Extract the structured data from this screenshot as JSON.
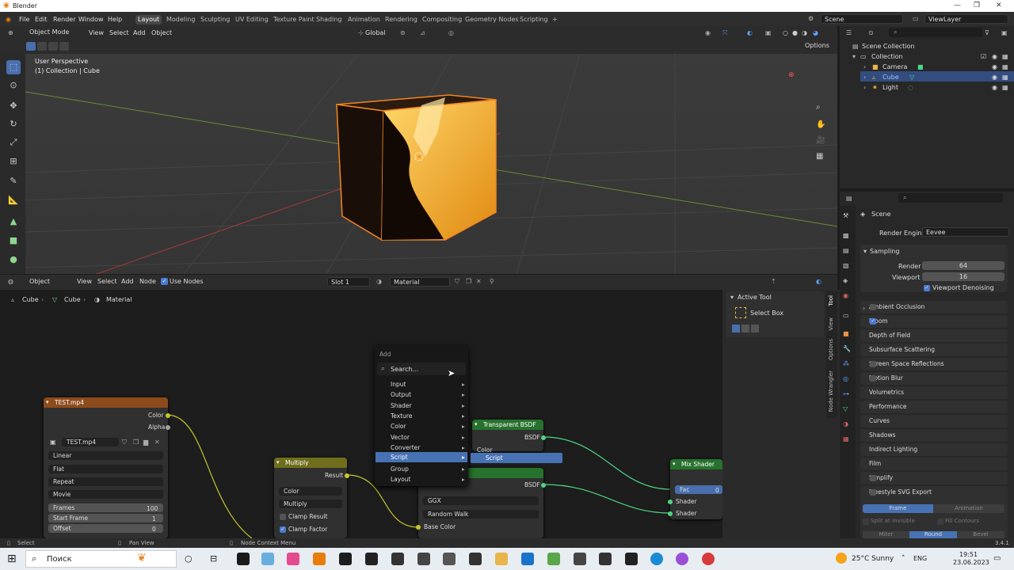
{
  "window": {
    "title": "Blender"
  },
  "menubar": {
    "menus": [
      "File",
      "Edit",
      "Render",
      "Window",
      "Help"
    ],
    "workspaces": [
      "Layout",
      "Modeling",
      "Sculpting",
      "UV Editing",
      "Texture Paint",
      "Shading",
      "Animation",
      "Rendering",
      "Compositing",
      "Geometry Nodes",
      "Scripting",
      "+"
    ],
    "active_workspace": "Layout",
    "scene": "Scene",
    "view_layer": "ViewLayer"
  },
  "viewport_header": {
    "mode": "Object Mode",
    "menus": [
      "View",
      "Select",
      "Add",
      "Object"
    ],
    "transform": "Global",
    "options": "Options"
  },
  "viewport": {
    "perspective": "User Perspective",
    "collection": "(1) Collection | Cube"
  },
  "node_header": {
    "type": "Object",
    "menus": [
      "View",
      "Select",
      "Add",
      "Node"
    ],
    "use_nodes": "Use Nodes",
    "slot": "Slot 1",
    "material": "Material"
  },
  "breadcrumb": [
    "Cube",
    "Cube",
    "Material"
  ],
  "add_menu": {
    "title": "Add",
    "search": "Search...",
    "items": [
      "Input",
      "Output",
      "Shader",
      "Texture",
      "Color",
      "Vector",
      "Converter",
      "Script",
      "Group",
      "Layout"
    ],
    "highlighted": "Script",
    "submenu_item": "Script"
  },
  "nodes": {
    "image": {
      "title": "TEST.mp4",
      "out1": "Color",
      "out2": "Alpha",
      "file": "TEST.mp4",
      "interp": "Linear",
      "proj": "Flat",
      "ext": "Repeat",
      "source": "Movie",
      "frames_label": "Frames",
      "frames": "100",
      "start_label": "Start Frame",
      "start": "1",
      "offset_label": "Offset",
      "offset": "0"
    },
    "multiply": {
      "title": "Multiply",
      "out": "Result",
      "type": "Color",
      "op": "Multiply",
      "clamp_result": "Clamp Result",
      "clamp_factor": "Clamp Factor"
    },
    "transparent": {
      "title": "Transparent BSDF",
      "out": "BSDF",
      "color": "Color"
    },
    "principled": {
      "out": "BSDF",
      "dist": "GGX",
      "sss": "Random Walk",
      "base_color": "Base Color"
    },
    "mix": {
      "title": "Mix Shader",
      "fac": "Fac",
      "fac_val": "0",
      "in1": "Shader",
      "in2": "Shader"
    }
  },
  "npanel": {
    "section": "Active Tool",
    "tool": "Select Box",
    "tabs": [
      "Tool",
      "View",
      "Options",
      "Node Wrangler"
    ]
  },
  "outliner": {
    "root": "Scene Collection",
    "collection": "Collection",
    "items": [
      "Camera",
      "Cube",
      "Light"
    ],
    "selected": "Cube"
  },
  "properties": {
    "scene": "Scene",
    "render_engine_label": "Render Engine",
    "render_engine": "Eevee",
    "sampling": "Sampling",
    "render_label": "Render",
    "render": "64",
    "viewport_label": "Viewport",
    "viewport": "16",
    "denoise": "Viewport Denoising",
    "panels": [
      "Ambient Occlusion",
      "Bloom",
      "Depth of Field",
      "Subsurface Scattering",
      "Screen Space Reflections",
      "Motion Blur",
      "Volumetrics",
      "Performance",
      "Curves",
      "Shadows",
      "Indirect Lighting",
      "Film",
      "Simplify",
      "Freestyle SVG Export"
    ],
    "frame_tab": "Frame",
    "animation_tab": "Animation",
    "split_invisible": "Split at Invisible",
    "fill_contours": "Fill Contours",
    "miter": "Miter",
    "round": "Round",
    "bevel": "Bevel"
  },
  "status": {
    "select": "Select",
    "pan": "Pan View",
    "ctx": "Node Context Menu",
    "version": "3.4.1"
  },
  "taskbar": {
    "search": "Поиск",
    "weather": "25°C  Sunny",
    "lang": "ENG",
    "time": "19:51",
    "date": "23.06.2023"
  }
}
